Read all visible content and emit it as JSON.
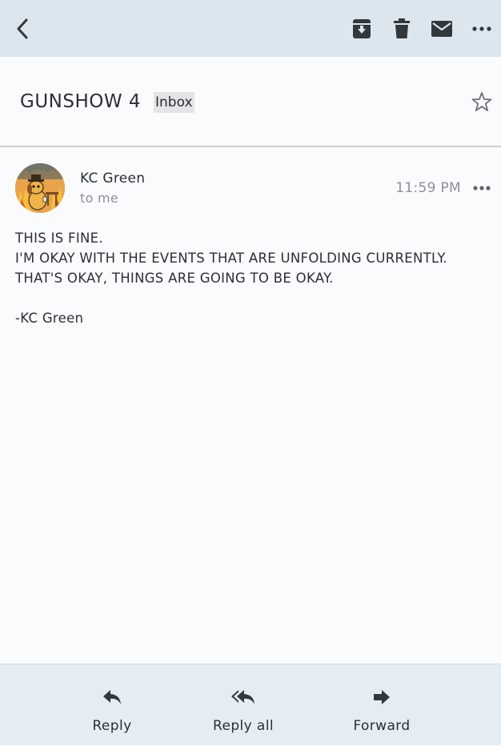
{
  "toolbar": {
    "back": "back-icon",
    "archive": "archive-icon",
    "delete": "trash-icon",
    "mark_unread": "envelope-icon",
    "more": "more-horizontal-icon"
  },
  "email": {
    "subject": "GUNSHOW 4",
    "label": "Inbox",
    "starred": false,
    "sender": "KC Green",
    "recipient": "to me",
    "time": "11:59 PM",
    "body": [
      "THIS IS FINE.",
      "I'M OKAY WITH THE EVENTS THAT ARE UNFOLDING CURRENTLY.",
      "THAT'S OKAY, THINGS ARE GOING TO BE OKAY.",
      "",
      "-KC Green"
    ]
  },
  "actions": {
    "reply": "Reply",
    "reply_all": "Reply all",
    "forward": "Forward"
  },
  "colors": {
    "toolbar_bg": "#dbe6ef",
    "bottom_bg": "#e5ecf3",
    "text": "#2b2f33",
    "muted": "#8c9196",
    "icon": "#33383d"
  }
}
